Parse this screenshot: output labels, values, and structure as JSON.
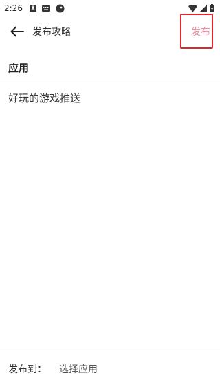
{
  "status_bar": {
    "time": "2:26",
    "icons": [
      "notification-a-icon",
      "keyboard-icon",
      "game-controller-icon",
      "wifi-icon",
      "signal-icon",
      "battery-icon"
    ]
  },
  "top_bar": {
    "title": "发布攻略",
    "publish_label": "发布",
    "publish_color": "#ee8fa0",
    "highlight_color": "#e0262a"
  },
  "app_section": {
    "heading": "应用",
    "content": "好玩的游戏推送"
  },
  "bottom_bar": {
    "label": "发布到：",
    "select_label": "选择应用"
  }
}
